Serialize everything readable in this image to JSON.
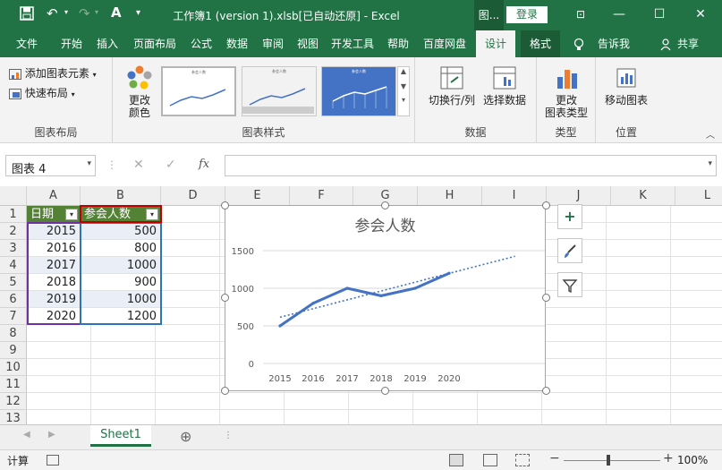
{
  "window": {
    "title": "工作簿1 (version 1).xlsb[已自动还原]  -  Excel",
    "context_tab": "图...",
    "login_label": "登录",
    "controls": {
      "minimize": "—",
      "restore": "☐",
      "close": "✕",
      "ribbon_display": "⊡"
    }
  },
  "ribbon_tabs": [
    "文件",
    "开始",
    "插入",
    "页面布局",
    "公式",
    "数据",
    "审阅",
    "视图",
    "开发工具",
    "帮助",
    "百度网盘",
    "设计",
    "格式"
  ],
  "ribbon_tabs_active": "设计",
  "tell_me": "告诉我",
  "share": "共享",
  "ribbon": {
    "groups": {
      "layout": {
        "label": "图表布局",
        "add_element": "添加图表元素",
        "quick_layout": "快速布局"
      },
      "styles": {
        "label": "图表样式",
        "change_colors": "更改\n颜色",
        "gallery_titles": [
          "参会人数",
          "参会人数",
          "参会人数"
        ]
      },
      "data": {
        "label": "数据",
        "switch": "切换行/列",
        "select": "选择数据"
      },
      "type": {
        "label": "类型",
        "change_type": "更改\n图表类型"
      },
      "location": {
        "label": "位置",
        "move_chart": "移动图表"
      }
    }
  },
  "formula_bar": {
    "name_box": "图表 4",
    "fx": "fx",
    "cancel": "✕",
    "enter": "✓",
    "value": ""
  },
  "columns": [
    "A",
    "B",
    "D",
    "E",
    "F",
    "G",
    "H",
    "I",
    "J",
    "K",
    "L"
  ],
  "rows": [
    "1",
    "2",
    "3",
    "4",
    "5",
    "6",
    "7",
    "8",
    "9",
    "10",
    "11",
    "12",
    "13"
  ],
  "table": {
    "headers": [
      "日期",
      "参会人数"
    ],
    "rows": [
      [
        "2015",
        "500"
      ],
      [
        "2016",
        "800"
      ],
      [
        "2017",
        "1000"
      ],
      [
        "2018",
        "900"
      ],
      [
        "2019",
        "1000"
      ],
      [
        "2020",
        "1200"
      ]
    ]
  },
  "chart_data": {
    "type": "line",
    "title": "参会人数",
    "categories": [
      "2015",
      "2016",
      "2017",
      "2018",
      "2019",
      "2020"
    ],
    "series": [
      {
        "values": [
          500,
          800,
          1000,
          900,
          1000,
          1200
        ]
      }
    ],
    "trendline": "linear",
    "ylim": [
      0,
      1500
    ],
    "yticks": [
      "0",
      "500",
      "1000",
      "1500"
    ],
    "grid": true,
    "legend": "none",
    "line_color": "#4472c4"
  },
  "chart_side_buttons": {
    "elements": "+",
    "styles": "brush",
    "filter": "filter"
  },
  "sheets": {
    "tabs": [
      "Sheet1"
    ],
    "add": "⊕"
  },
  "status": {
    "mode": "计算",
    "zoom": "100%",
    "zoom_out": "−",
    "zoom_in": "+"
  },
  "colors": {
    "accent": "#217346",
    "table_header": "#548235"
  }
}
